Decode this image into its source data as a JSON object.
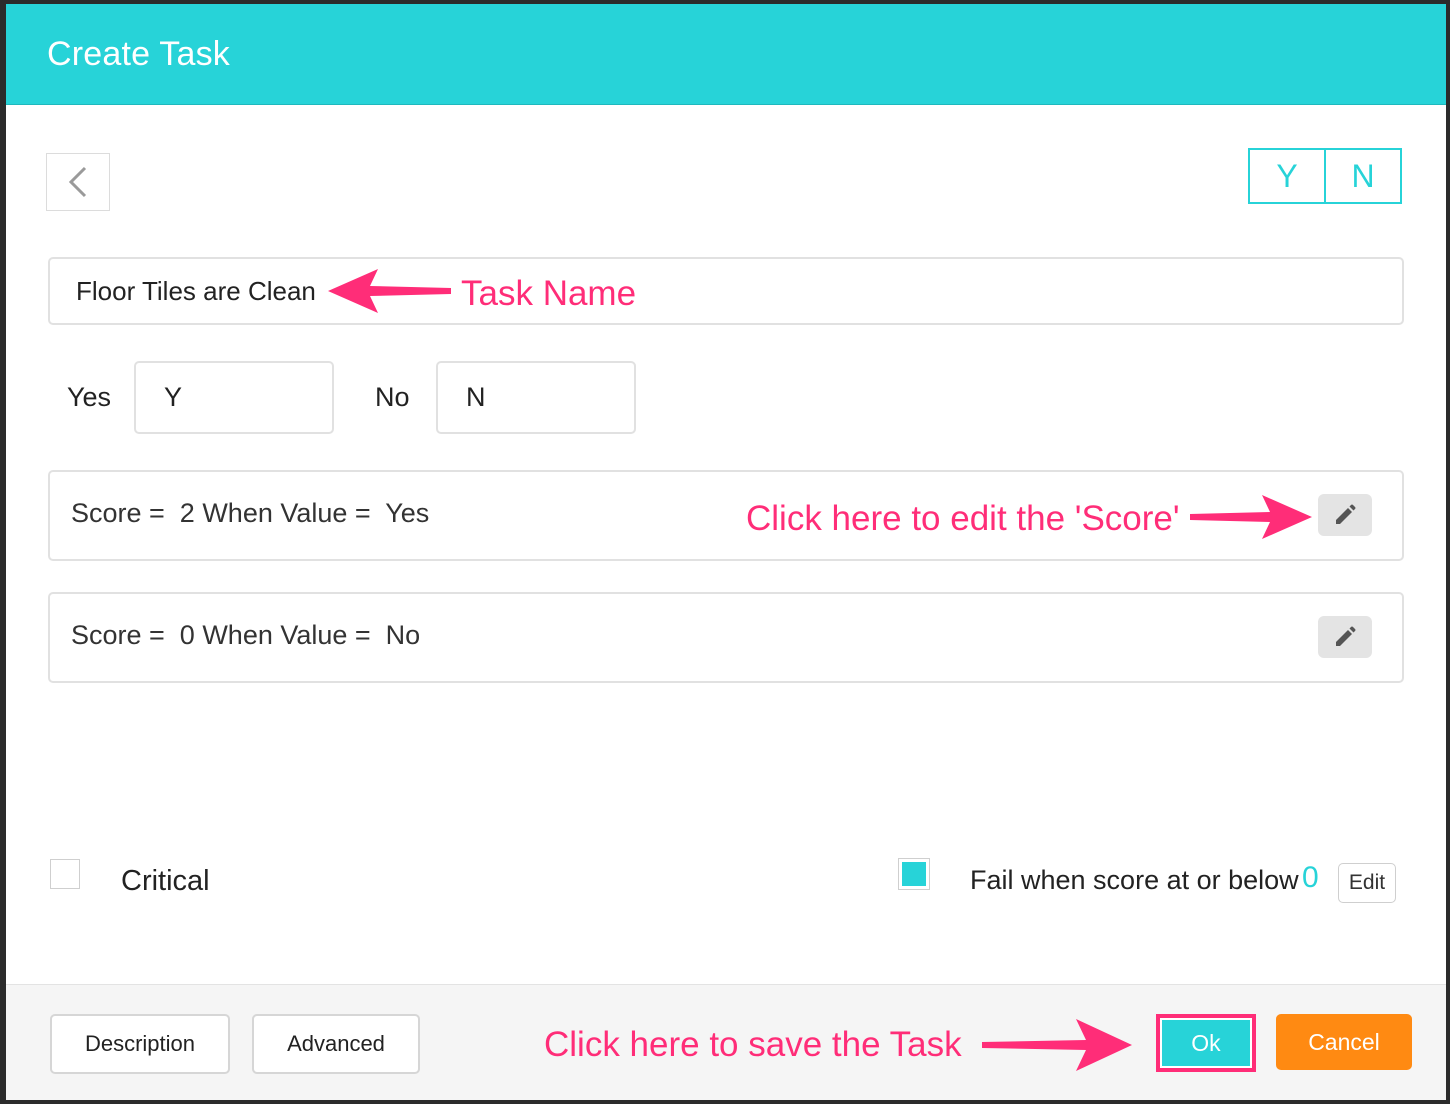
{
  "dialog": {
    "title": "Create Task",
    "toggle": {
      "yes": "Y",
      "no": "N"
    }
  },
  "task": {
    "name": "Floor Tiles are Clean"
  },
  "values": {
    "yes_label": "Yes",
    "yes_value": "Y",
    "no_label": "No",
    "no_value": "N"
  },
  "scores": [
    {
      "text": "Score =  2 When Value =  Yes"
    },
    {
      "text": "Score =  0 When Value =  No"
    }
  ],
  "options": {
    "critical_label": "Critical",
    "fail_label": "Fail when score at or below",
    "fail_value": "0",
    "fail_edit": "Edit"
  },
  "footer": {
    "description": "Description",
    "advanced": "Advanced",
    "ok": "Ok",
    "cancel": "Cancel"
  },
  "annotations": {
    "task_name": "Task Name",
    "edit_score": "Click here to edit the 'Score'",
    "save_task": "Click here to save the Task"
  },
  "colors": {
    "accent": "#27d3d8",
    "annotation": "#ff2d78",
    "cancel": "#ff8a12"
  }
}
